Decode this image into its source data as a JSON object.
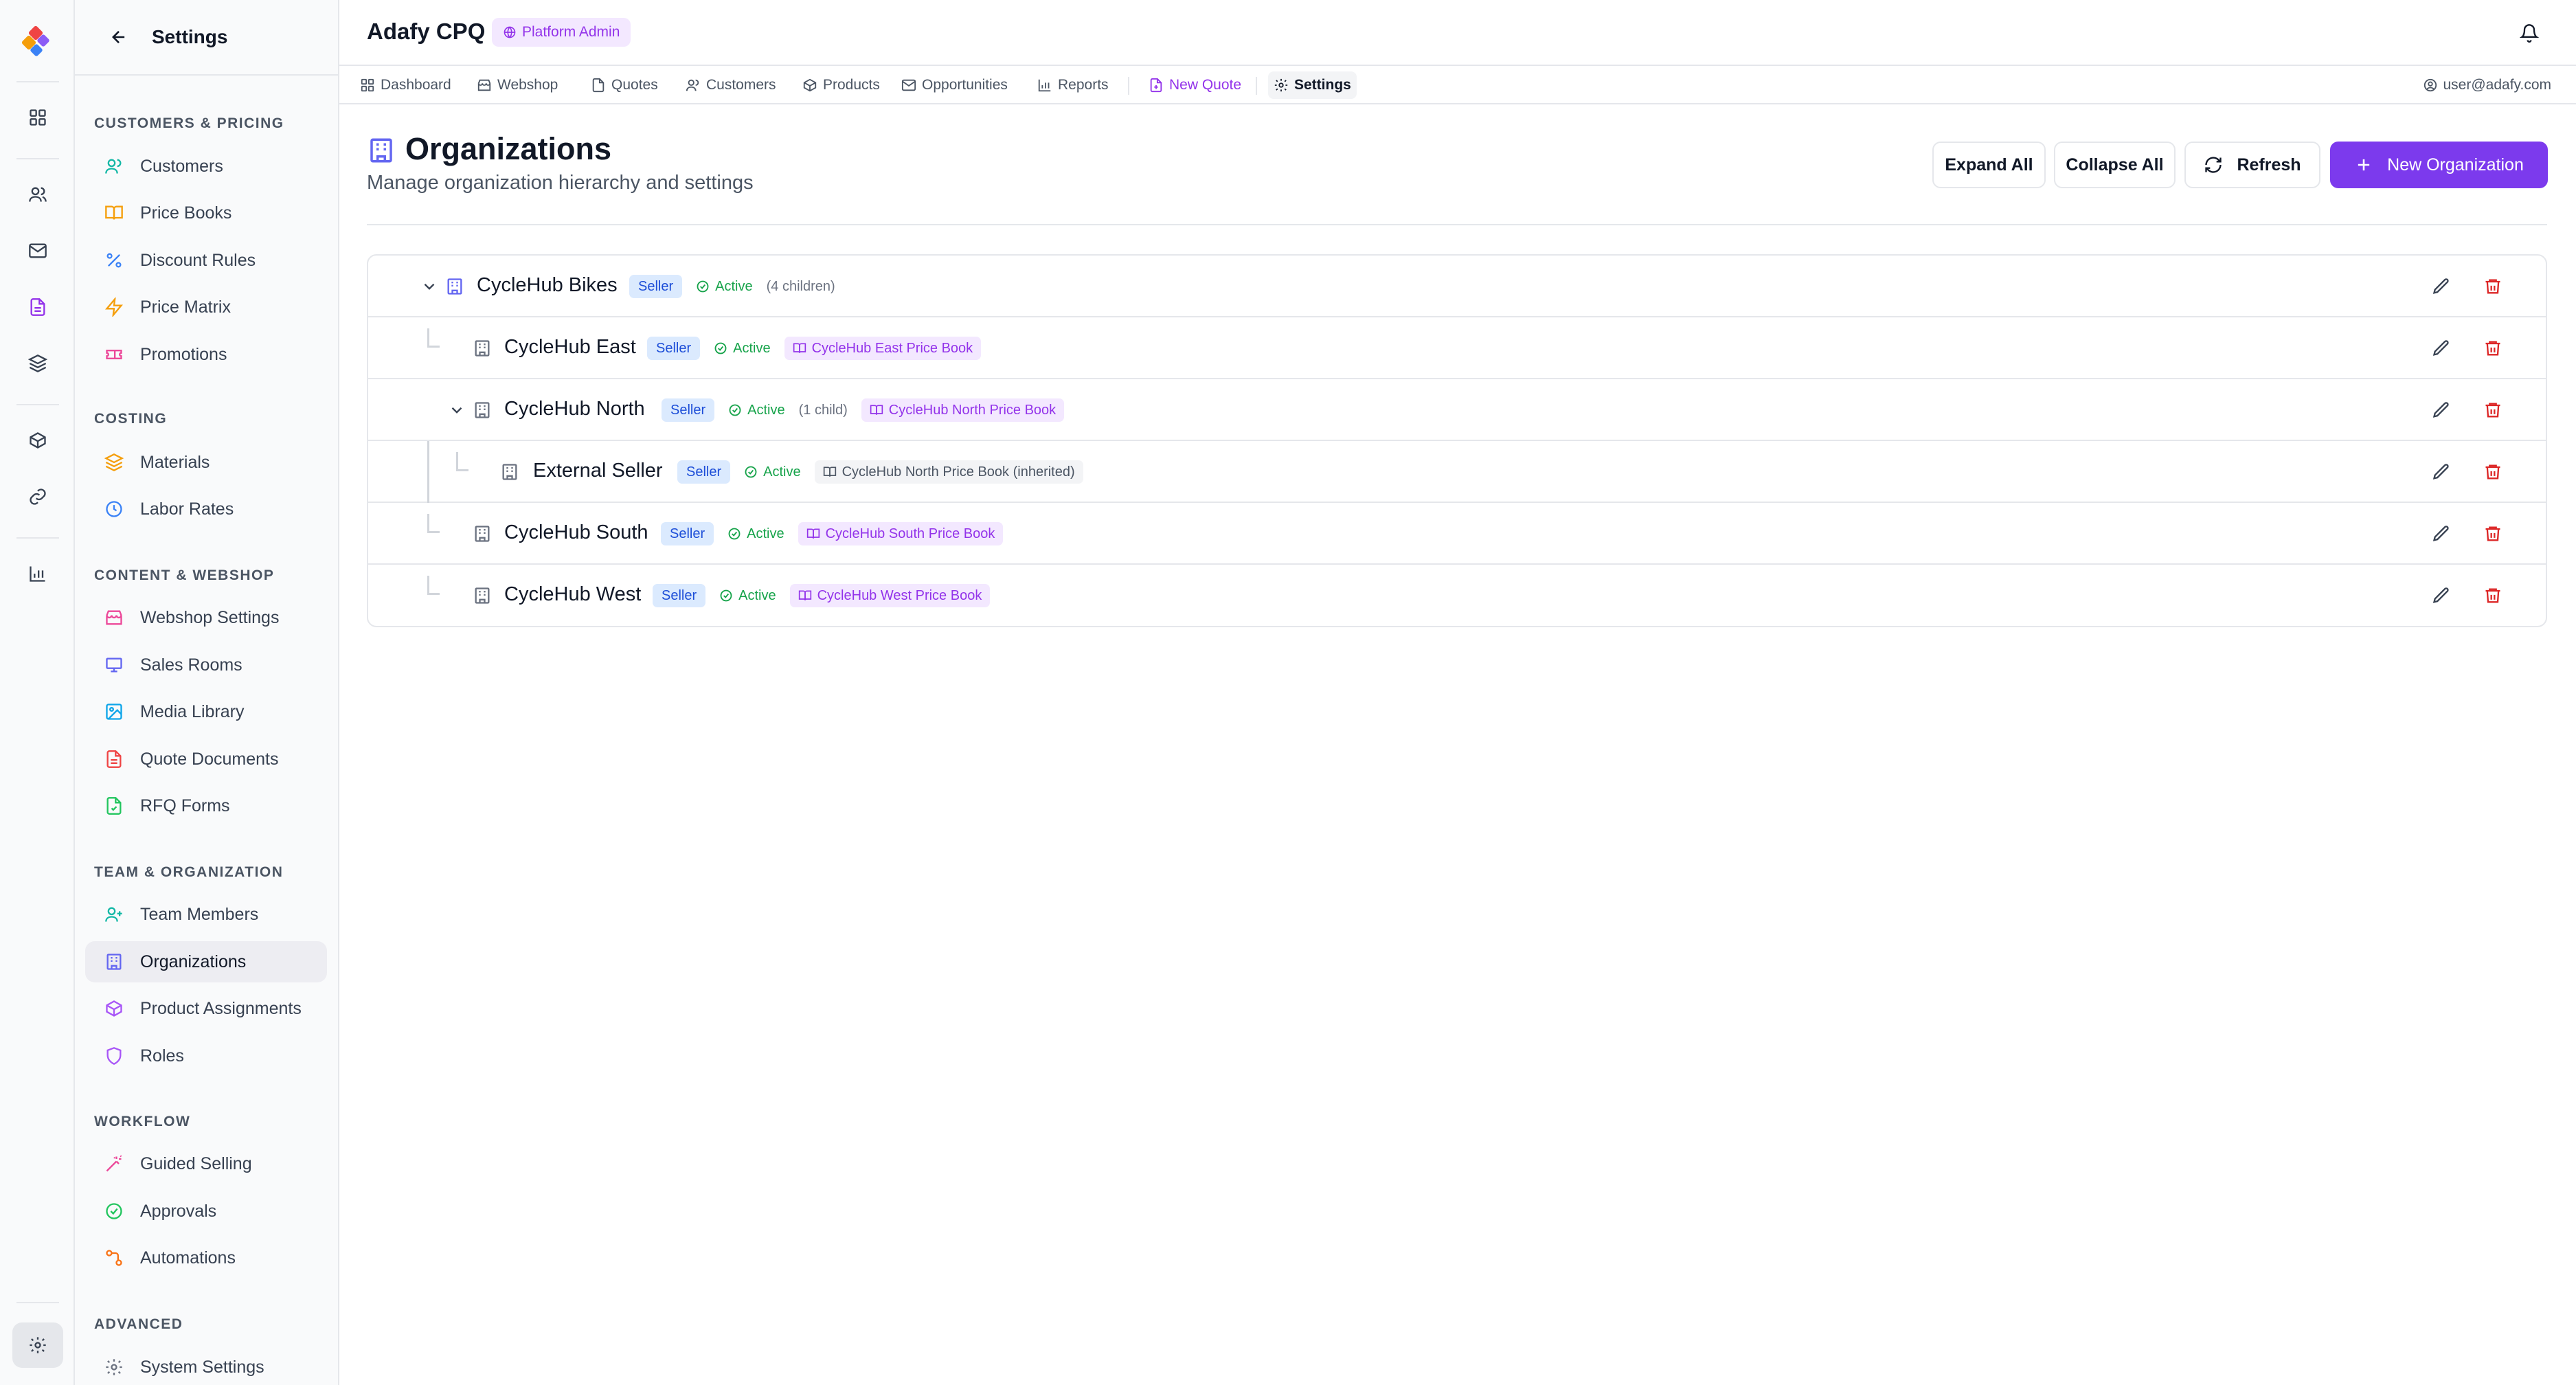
{
  "sidebar": {
    "back_title": "Settings",
    "sections": {
      "customers_pricing": "CUSTOMERS & PRICING",
      "costing": "COSTING",
      "content_webshop": "CONTENT & WEBSHOP",
      "team_org": "TEAM & ORGANIZATION",
      "workflow": "WORKFLOW",
      "advanced": "ADVANCED"
    },
    "items": {
      "customers": "Customers",
      "price_books": "Price Books",
      "discount_rules": "Discount Rules",
      "price_matrix": "Price Matrix",
      "promotions": "Promotions",
      "materials": "Materials",
      "labor_rates": "Labor Rates",
      "webshop_settings": "Webshop Settings",
      "sales_rooms": "Sales Rooms",
      "media_library": "Media Library",
      "quote_documents": "Quote Documents",
      "rfq_forms": "RFQ Forms",
      "team_members": "Team Members",
      "organizations": "Organizations",
      "product_assignments": "Product Assignments",
      "roles": "Roles",
      "guided_selling": "Guided Selling",
      "approvals": "Approvals",
      "automations": "Automations",
      "system_settings": "System Settings"
    }
  },
  "header": {
    "app_title": "Adafy CPQ",
    "role_badge": "Platform Admin",
    "user_email": "user@adafy.com"
  },
  "nav": {
    "dashboard": "Dashboard",
    "webshop": "Webshop",
    "quotes": "Quotes",
    "customers": "Customers",
    "products": "Products",
    "opportunities": "Opportunities",
    "reports": "Reports",
    "new_quote": "New Quote",
    "settings": "Settings"
  },
  "page": {
    "title": "Organizations",
    "subtitle": "Manage organization hierarchy and settings",
    "expand_all": "Expand All",
    "collapse_all": "Collapse All",
    "refresh": "Refresh",
    "new_org": "New Organization"
  },
  "orgs": {
    "r0": {
      "name": "CycleHub Bikes",
      "type": "Seller",
      "status": "Active",
      "children": "(4 children)"
    },
    "r1": {
      "name": "CycleHub East",
      "type": "Seller",
      "status": "Active",
      "price_book": "CycleHub East Price Book"
    },
    "r2": {
      "name": "CycleHub North",
      "type": "Seller",
      "status": "Active",
      "children": "(1 child)",
      "price_book": "CycleHub North Price Book"
    },
    "r3": {
      "name": "External Seller",
      "type": "Seller",
      "status": "Active",
      "price_book": "CycleHub North Price Book (inherited)"
    },
    "r4": {
      "name": "CycleHub South",
      "type": "Seller",
      "status": "Active",
      "price_book": "CycleHub South Price Book"
    },
    "r5": {
      "name": "CycleHub West",
      "type": "Seller",
      "status": "Active",
      "price_book": "CycleHub West Price Book"
    }
  },
  "colors": {
    "accent": "#7c3aed",
    "seller_badge_bg": "#dbeafe",
    "active_green": "#16a34a",
    "price_book_purple": "#9333ea",
    "delete_red": "#dc2626"
  }
}
